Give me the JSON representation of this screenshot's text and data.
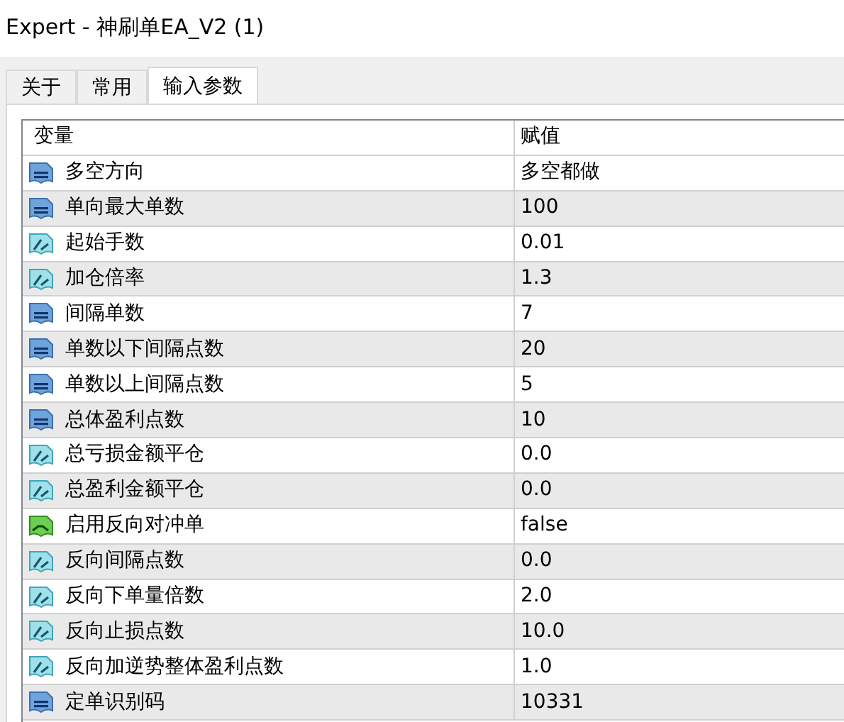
{
  "window": {
    "title": "Expert - 神刷单EA_V2 (1)"
  },
  "tabs": [
    {
      "label": "关于",
      "selected": false
    },
    {
      "label": "常用",
      "selected": false
    },
    {
      "label": "输入参数",
      "selected": true
    }
  ],
  "table": {
    "columns": [
      "变量",
      "赋值"
    ],
    "rows": [
      {
        "kind": "int",
        "name": "多空方向",
        "value": "多空都做"
      },
      {
        "kind": "int",
        "name": "单向最大单数",
        "value": "100"
      },
      {
        "kind": "double",
        "name": "起始手数",
        "value": "0.01"
      },
      {
        "kind": "double",
        "name": "加仓倍率",
        "value": "1.3"
      },
      {
        "kind": "int",
        "name": "间隔单数",
        "value": "7"
      },
      {
        "kind": "int",
        "name": "单数以下间隔点数",
        "value": "20"
      },
      {
        "kind": "int",
        "name": "单数以上间隔点数",
        "value": "5"
      },
      {
        "kind": "int",
        "name": "总体盈利点数",
        "value": "10"
      },
      {
        "kind": "double",
        "name": "总亏损金额平仓",
        "value": "0.0"
      },
      {
        "kind": "double",
        "name": "总盈利金额平仓",
        "value": "0.0"
      },
      {
        "kind": "bool",
        "name": "启用反向对冲单",
        "value": "false"
      },
      {
        "kind": "double",
        "name": "反向间隔点数",
        "value": "0.0"
      },
      {
        "kind": "double",
        "name": "反向下单量倍数",
        "value": "2.0"
      },
      {
        "kind": "double",
        "name": "反向止损点数",
        "value": "10.0"
      },
      {
        "kind": "double",
        "name": "反向加逆势整体盈利点数",
        "value": "1.0"
      },
      {
        "kind": "int",
        "name": "定单识别码",
        "value": "10331"
      }
    ]
  }
}
